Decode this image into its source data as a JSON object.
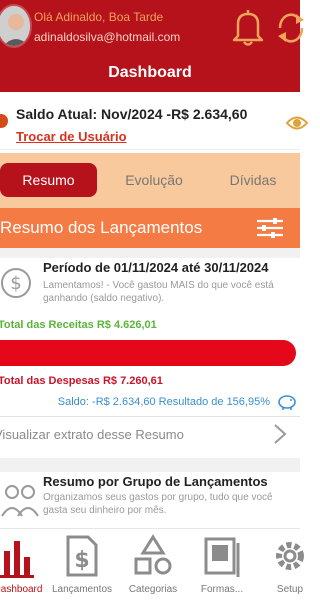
{
  "header": {
    "greeting": "Olá Adinaldo, Boa Tarde",
    "email": "adinaldosilva@hotmail.com",
    "title": "Dashboard"
  },
  "saldo": {
    "text": "Saldo Atual: Nov/2024 -R$ 2.634,60",
    "switch_user": "Trocar de Usuário"
  },
  "tabs": [
    {
      "label": "Resumo",
      "active": true
    },
    {
      "label": "Evolução",
      "active": false
    },
    {
      "label": "Dívidas",
      "active": false
    }
  ],
  "resumo": {
    "title": "Resumo dos Lançamentos",
    "period": "Período de 01/11/2024 até 30/11/2024",
    "message": "Lamentamos! - Você gastou MAIS do que você está ganhando (saldo negativo).",
    "receitas": "Total das Receitas R$ 4.626,01",
    "despesas": "Total das Despesas R$ 7.260,61",
    "saldo_resultado": "Saldo: -R$ 2.634,60 Resultado de 156,95%",
    "extrato_link": "Visualizar extrato desse Resumo"
  },
  "grupo": {
    "title": "Resumo por Grupo de Lançamentos",
    "description": "Organizamos seus gastos por grupo, tudo que você gasta seu dinheiro por mês."
  },
  "bottom_nav": [
    {
      "label": "Dashboard",
      "icon": "bar-chart-icon",
      "active": true
    },
    {
      "label": "Lançamentos",
      "icon": "dollar-document-icon",
      "active": false
    },
    {
      "label": "Categorias",
      "icon": "shapes-icon",
      "active": false
    },
    {
      "label": "Formas...",
      "icon": "payment-forms-icon",
      "active": false
    },
    {
      "label": "Setup",
      "icon": "gear-icon",
      "active": false
    }
  ],
  "colors": {
    "primary": "#b5121b",
    "orange": "#f47b43",
    "tab_bg": "#f7c99d",
    "receitas": "#5bb43a",
    "despesas": "#e5081a",
    "saldo_blue": "#3a8fd0"
  }
}
